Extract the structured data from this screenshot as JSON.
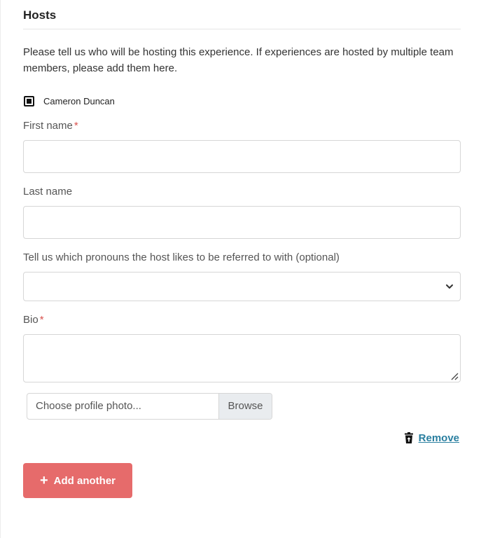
{
  "section": {
    "title": "Hosts",
    "intro": "Please tell us who will be hosting this experience. If experiences are hosted by multiple team members, please add them here."
  },
  "host_checkbox": {
    "label": "Cameron Duncan",
    "checked": true
  },
  "form": {
    "first_name_label": "First name",
    "first_name_value": "",
    "last_name_label": "Last name",
    "last_name_value": "",
    "pronouns_label": "Tell us which pronouns the host likes to be referred to with (optional)",
    "pronouns_selected": "",
    "bio_label": "Bio",
    "bio_value": "",
    "required_marker": "*"
  },
  "photo": {
    "placeholder": "Choose profile photo...",
    "browse_label": "Browse"
  },
  "actions": {
    "remove_label": "Remove",
    "add_label": "Add another"
  },
  "colors": {
    "accent_button": "#e66b6b",
    "link": "#2a7fa0",
    "required": "#d9534f"
  }
}
